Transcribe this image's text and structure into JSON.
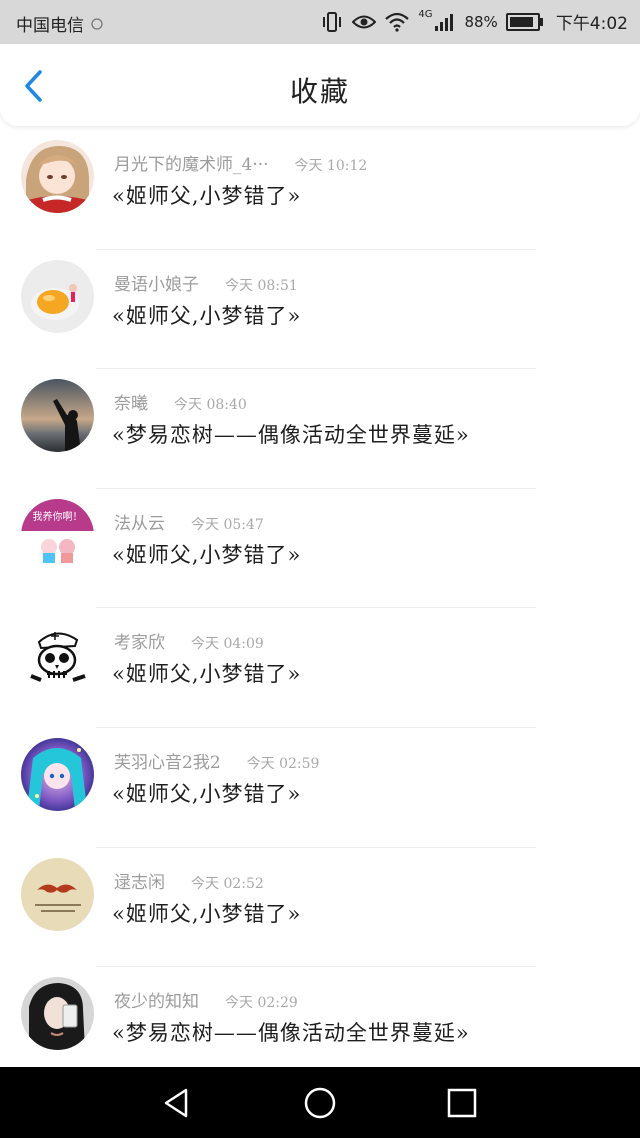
{
  "status": {
    "carrier": "中国电信",
    "battery_pct": "88%",
    "time": "下午4:02",
    "network": "4G"
  },
  "header": {
    "title": "收藏"
  },
  "favorites": [
    {
      "name": "月光下的魔术师_4···",
      "time": "今天 10:12",
      "content": "«姬师父,小梦错了»",
      "avatar": "anime-girl"
    },
    {
      "name": "曼语小娘子",
      "time": "今天 08:51",
      "content": "«姬师父,小梦错了»",
      "avatar": "orange-plate"
    },
    {
      "name": "奈曦",
      "time": "今天 08:40",
      "content": "«梦易恋树——偶像活动全世界蔓延»",
      "avatar": "sunset-silhouette"
    },
    {
      "name": "法从云",
      "time": "今天 05:47",
      "content": "«姬师父,小梦错了»",
      "avatar_label": "我养你啊！",
      "avatar": "cartoon-couple"
    },
    {
      "name": "考家欣",
      "time": "今天 04:09",
      "content": "«姬师父,小梦错了»",
      "avatar": "skull-sailor"
    },
    {
      "name": "芙羽心音2我2",
      "time": "今天 02:59",
      "content": "«姬师父,小梦错了»",
      "avatar": "blue-hair-girl"
    },
    {
      "name": "逯志闲",
      "time": "今天 02:52",
      "content": "«姬师父,小梦错了»",
      "avatar": "mustache"
    },
    {
      "name": "夜少的知知",
      "time": "今天 02:29",
      "content": "«梦易恋树——偶像活动全世界蔓延»",
      "avatar": "selfie-girl"
    }
  ],
  "colors": {
    "accent": "#1e88e5",
    "status_bar": "#d8d8d8",
    "nav_bar": "#000000"
  },
  "icons": {
    "back": "chevron-left-icon",
    "nav": [
      "back-triangle-icon",
      "home-circle-icon",
      "recents-square-icon"
    ]
  }
}
